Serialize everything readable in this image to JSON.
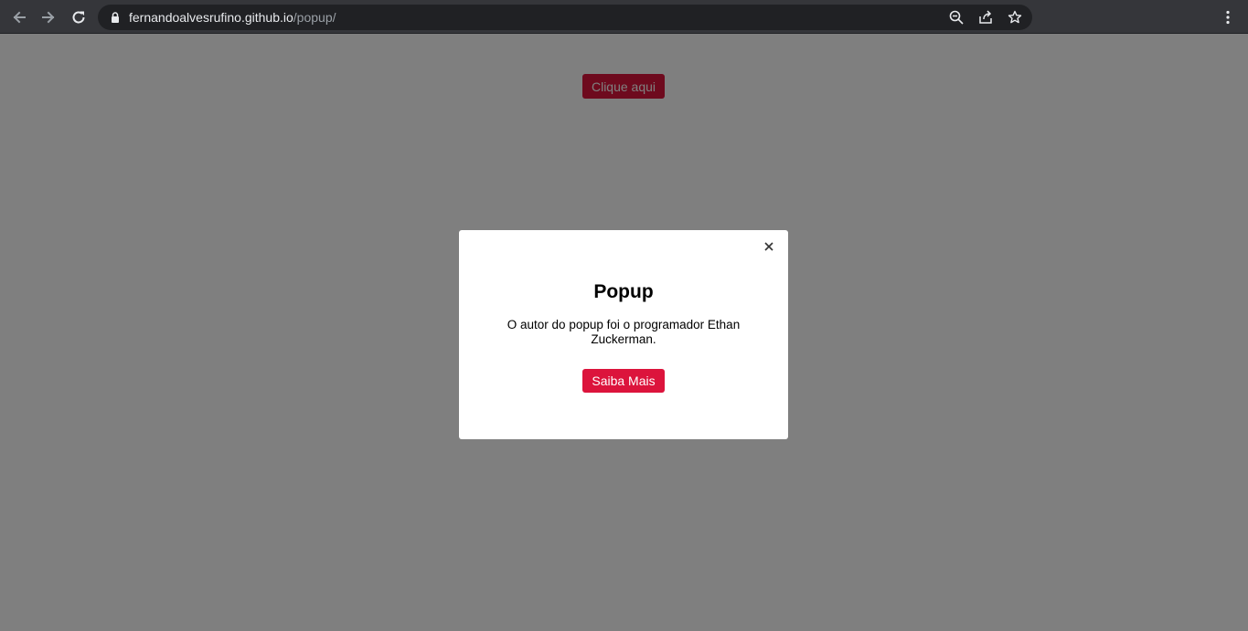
{
  "browser": {
    "url_host": "fernandoalvesrufino.github.io",
    "url_path": "/popup/",
    "icons": {
      "back": "arrow-left-icon",
      "forward": "arrow-right-icon",
      "reload": "reload-icon",
      "lock": "lock-icon",
      "zoom": "zoom-out-icon",
      "share": "share-icon",
      "bookmark": "star-icon",
      "menu": "kebab-menu-icon"
    },
    "colors": {
      "toolbar": "#35363a",
      "omnibox": "#202124"
    }
  },
  "page": {
    "open_button_label": "Clique aqui",
    "accent_color": "#dc143c"
  },
  "popup": {
    "title": "Popup",
    "text": "O autor do popup foi o programador Ethan Zuckerman.",
    "button_label": "Saiba Mais",
    "close_icon": "close-icon"
  }
}
